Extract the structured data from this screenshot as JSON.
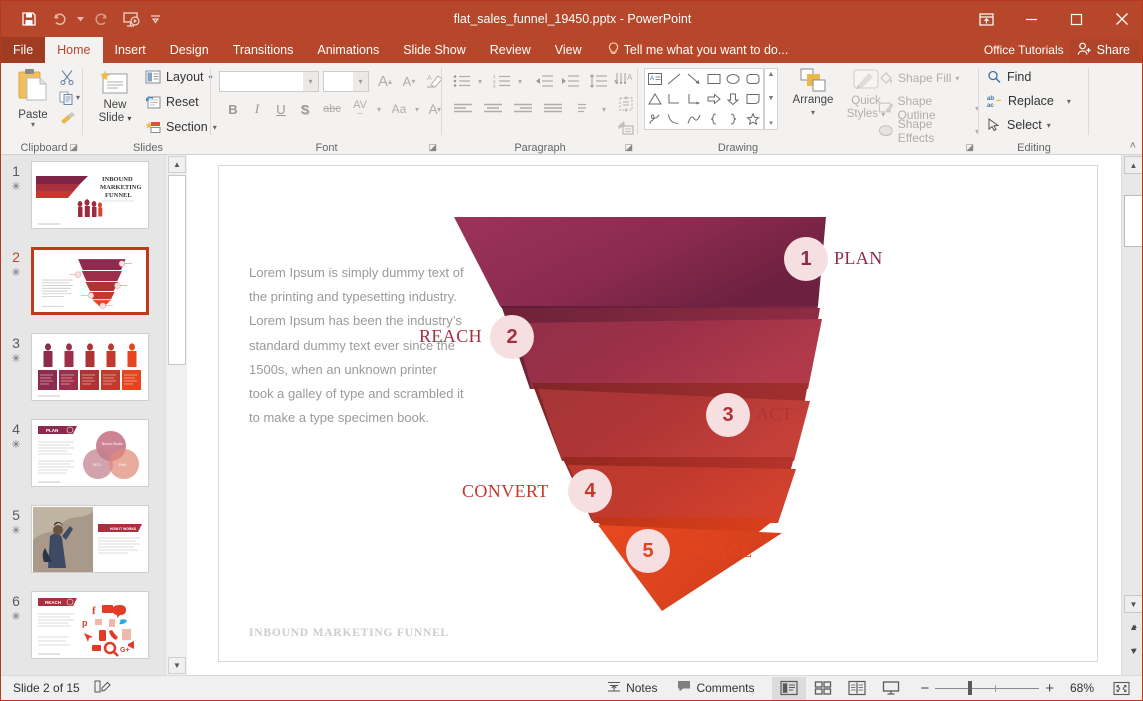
{
  "window": {
    "title": "flat_sales_funnel_19450.pptx - PowerPoint",
    "quick_access": [
      {
        "name": "save-icon",
        "label": "Save"
      },
      {
        "name": "undo-icon",
        "label": "Undo"
      },
      {
        "name": "redo-icon",
        "label": "Redo"
      },
      {
        "name": "start-presentation-icon",
        "label": "Start From Beginning"
      },
      {
        "name": "customize-quick-access-icon",
        "label": "Customize Quick Access Toolbar"
      }
    ],
    "controls": {
      "ribbon_display": "Ribbon Display Options",
      "minimize": "Minimize",
      "maximize": "Restore Down",
      "close": "Close"
    }
  },
  "ribbon": {
    "tabs": [
      {
        "label": "File",
        "active": false
      },
      {
        "label": "Home",
        "active": true
      },
      {
        "label": "Insert",
        "active": false
      },
      {
        "label": "Design",
        "active": false
      },
      {
        "label": "Transitions",
        "active": false
      },
      {
        "label": "Animations",
        "active": false
      },
      {
        "label": "Slide Show",
        "active": false
      },
      {
        "label": "Review",
        "active": false
      },
      {
        "label": "View",
        "active": false
      }
    ],
    "tell_me": "Tell me what you want to do...",
    "office_tutorials": "Office Tutorials",
    "share": "Share",
    "collapse_label": "Collapse the Ribbon",
    "groups": {
      "clipboard": {
        "label": "Clipboard",
        "paste": "Paste",
        "cut": "Cut",
        "copy": "Copy",
        "format_painter": "Format Painter"
      },
      "slides": {
        "label": "Slides",
        "new_slide": "New\nSlide",
        "new_slide_line1": "New",
        "new_slide_line2": "Slide",
        "layout": "Layout",
        "reset": "Reset",
        "section": "Section"
      },
      "font": {
        "label": "Font",
        "font_name": "",
        "font_size": "",
        "increase_size": "Increase Font Size",
        "decrease_size": "Decrease Font Size",
        "clear_formatting": "Clear All Formatting",
        "bold": "B",
        "italic": "I",
        "underline": "U",
        "shadow": "S",
        "strikethrough": "abc",
        "character_spacing": "AV",
        "change_case": "Aa",
        "font_color": "A"
      },
      "paragraph": {
        "label": "Paragraph"
      },
      "drawing": {
        "label": "Drawing",
        "arrange": "Arrange",
        "quick_styles_line1": "Quick",
        "quick_styles_line2": "Styles",
        "shape_fill": "Shape Fill",
        "shape_outline": "Shape Outline",
        "shape_effects": "Shape Effects"
      },
      "editing": {
        "label": "Editing",
        "find": "Find",
        "replace": "Replace",
        "select": "Select"
      }
    }
  },
  "thumbnails": {
    "star_glyph": "✳",
    "slides": [
      {
        "number": "1",
        "selected": false
      },
      {
        "number": "2",
        "selected": true
      },
      {
        "number": "3",
        "selected": false
      },
      {
        "number": "4",
        "selected": false
      },
      {
        "number": "5",
        "selected": false
      },
      {
        "number": "6",
        "selected": false
      }
    ]
  },
  "slide": {
    "body_text": "Lorem Ipsum is simply dummy text of the printing and typesetting industry. Lorem Ipsum has been the industry’s standard dummy text ever since the 1500s, when an unknown printer took a galley of type and scrambled it to make a type specimen book.",
    "footer": "INBOUND MARKETING FUNNEL",
    "funnel": {
      "stages": [
        {
          "number": "1",
          "label": "PLAN",
          "color": "#8c2b4f",
          "label_side": "right",
          "label_color": "#8c2b4f"
        },
        {
          "number": "2",
          "label": "REACH",
          "color": "#9e2f4a",
          "label_side": "left",
          "label_color": "#a42f42"
        },
        {
          "number": "3",
          "label": "ACT",
          "color": "#b03334",
          "label_side": "right",
          "label_color": "#b03334"
        },
        {
          "number": "4",
          "label": "CONVERT",
          "color": "#c33a2d",
          "label_side": "left",
          "label_color": "#c33a2d"
        },
        {
          "number": "5",
          "label": "ENGAGE",
          "color": "#e8451f",
          "label_side": "right",
          "label_color": "#e0451f"
        }
      ],
      "badge_fill": "#f6dfe0"
    }
  },
  "status_bar": {
    "slide_counter": "Slide 2 of 15",
    "notes_icon_label": "Notes",
    "notes": "Notes",
    "comments": "Comments",
    "views": [
      {
        "name": "normal-view-button",
        "active": true
      },
      {
        "name": "slide-sorter-view-button",
        "active": false
      },
      {
        "name": "reading-view-button",
        "active": false
      },
      {
        "name": "slide-show-button",
        "active": false
      }
    ],
    "zoom_out": "−",
    "zoom_in": "+",
    "zoom_level": "68%",
    "fit_slide_label": "Fit slide to current window"
  }
}
